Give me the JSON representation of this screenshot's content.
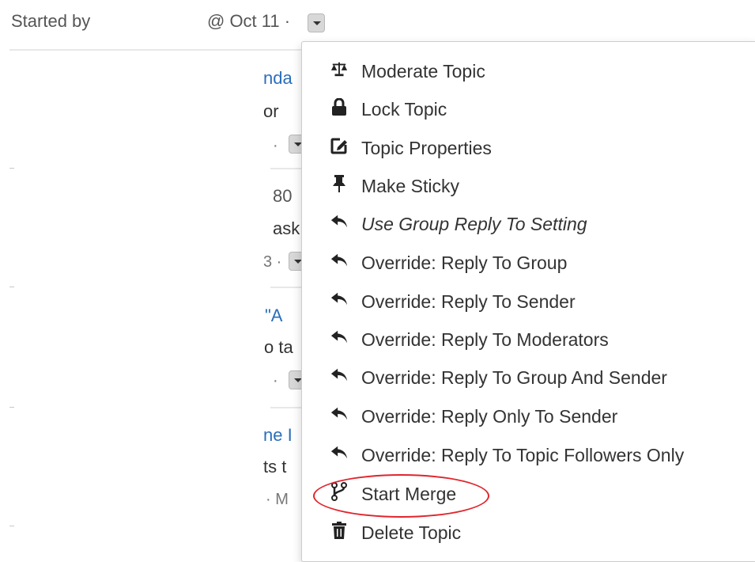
{
  "header": {
    "started_by_label": "Started by",
    "date": "@ Oct 11 ·"
  },
  "background_rows": [
    {
      "title": "nda",
      "snippet": "or",
      "meta": "·"
    },
    {
      "title": "80",
      "snippet": "ask",
      "meta": "3 ·"
    },
    {
      "title": "\"A",
      "snippet": "o ta",
      "meta": "·"
    },
    {
      "title": "ne I",
      "snippet": "ts t",
      "meta": "· M"
    }
  ],
  "menu": {
    "items": [
      {
        "label": "Moderate Topic",
        "icon": "balance-scale-icon"
      },
      {
        "label": "Lock Topic",
        "icon": "lock-icon"
      },
      {
        "label": "Topic Properties",
        "icon": "edit-icon"
      },
      {
        "label": "Make Sticky",
        "icon": "thumbtack-icon"
      },
      {
        "label": "Use Group Reply To Setting",
        "icon": "reply-icon"
      },
      {
        "label": "Override: Reply To Group",
        "icon": "reply-icon"
      },
      {
        "label": "Override: Reply To Sender",
        "icon": "reply-icon"
      },
      {
        "label": "Override: Reply To Moderators",
        "icon": "reply-icon"
      },
      {
        "label": "Override: Reply To Group And Sender",
        "icon": "reply-icon"
      },
      {
        "label": "Override: Reply Only To Sender",
        "icon": "reply-icon"
      },
      {
        "label": "Override: Reply To Topic Followers Only",
        "icon": "reply-icon"
      },
      {
        "label": "Start Merge",
        "icon": "code-branch-icon"
      },
      {
        "label": "Delete Topic",
        "icon": "trash-icon"
      }
    ]
  },
  "annotation": {
    "highlight_color": "#e0262d",
    "highlighted_item": "Start Merge"
  },
  "colors": {
    "link": "#2a6ebb",
    "text": "#333333"
  }
}
